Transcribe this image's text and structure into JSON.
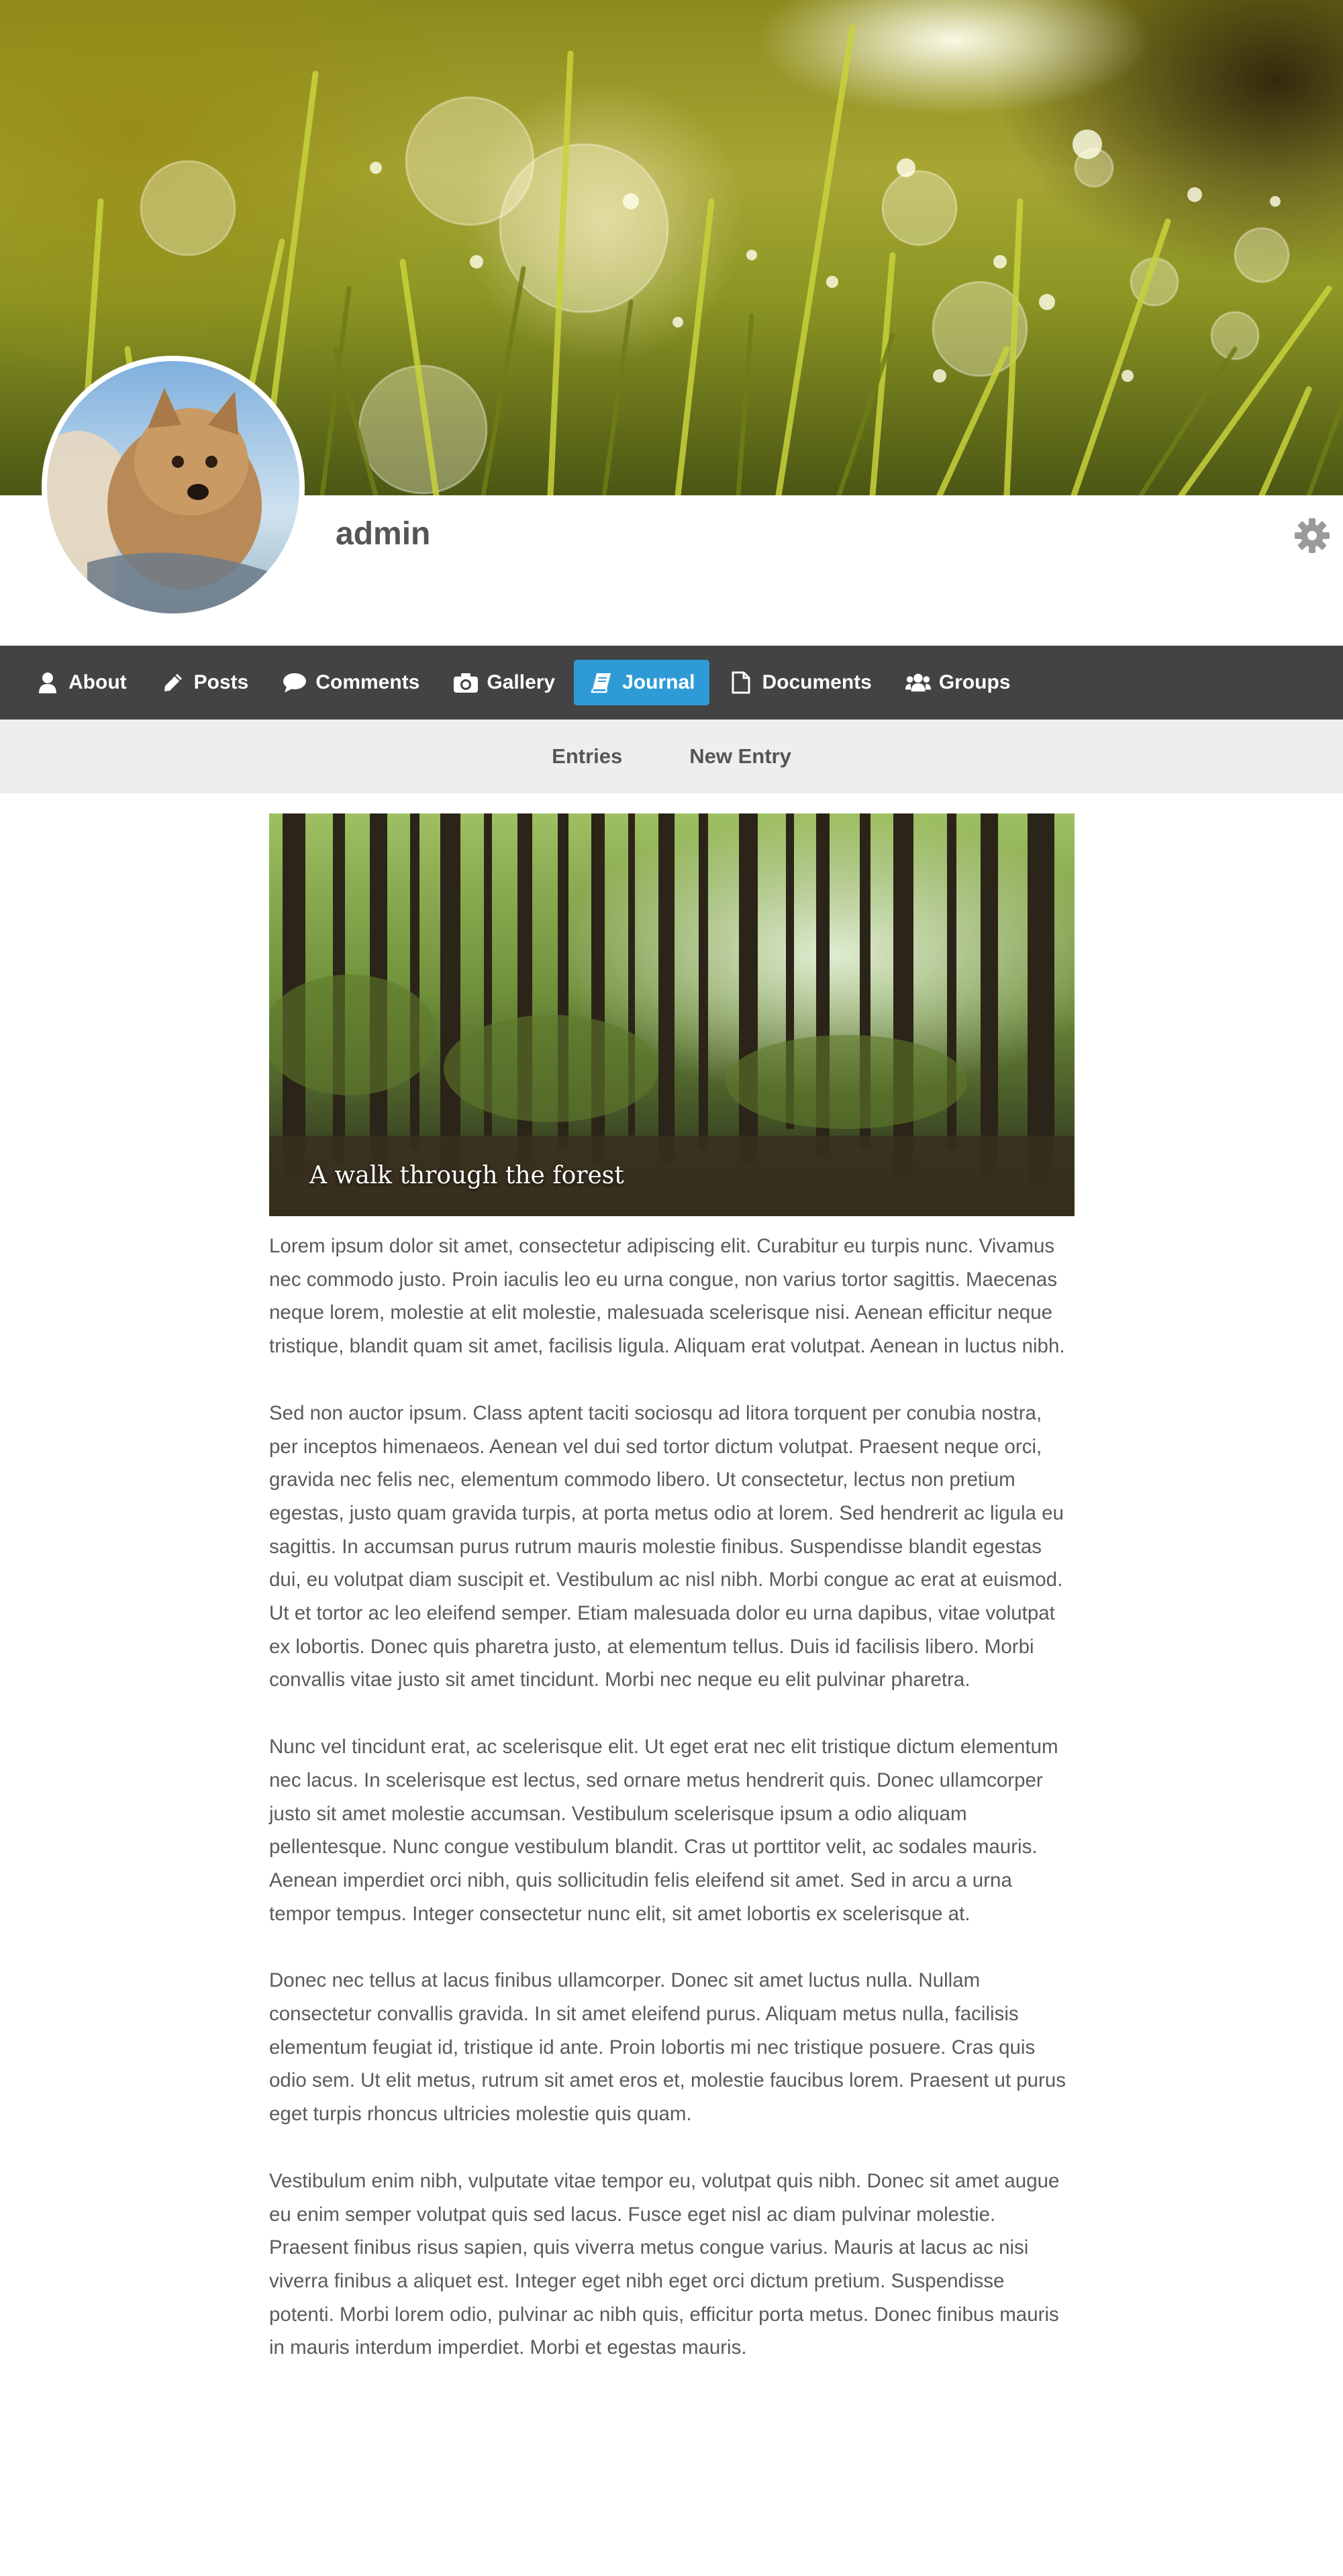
{
  "profile": {
    "username": "admin",
    "settings_icon": "gear-icon",
    "avatar_desc": "avatar-photo"
  },
  "nav": {
    "items": [
      {
        "label": "About",
        "icon": "user-icon",
        "active": false
      },
      {
        "label": "Posts",
        "icon": "pencil-icon",
        "active": false
      },
      {
        "label": "Comments",
        "icon": "comment-icon",
        "active": false
      },
      {
        "label": "Gallery",
        "icon": "camera-icon",
        "active": false
      },
      {
        "label": "Journal",
        "icon": "book-icon",
        "active": true
      },
      {
        "label": "Documents",
        "icon": "document-icon",
        "active": false
      },
      {
        "label": "Groups",
        "icon": "users-icon",
        "active": false
      }
    ],
    "active_color": "#2f9bd6",
    "bar_color": "#434343"
  },
  "subnav": {
    "items": [
      {
        "label": "Entries"
      },
      {
        "label": "New Entry"
      }
    ]
  },
  "entry": {
    "caption": "A walk through the forest",
    "paragraphs": [
      "Lorem ipsum dolor sit amet, consectetur adipiscing elit. Curabitur eu turpis nunc. Vivamus nec commodo justo. Proin iaculis leo eu urna congue, non varius tortor sagittis. Maecenas neque lorem, molestie at elit molestie, malesuada scelerisque nisi. Aenean efficitur neque tristique, blandit quam sit amet, facilisis ligula. Aliquam erat volutpat. Aenean in luctus nibh.",
      "Sed non auctor ipsum. Class aptent taciti sociosqu ad litora torquent per conubia nostra, per inceptos himenaeos. Aenean vel dui sed tortor dictum volutpat. Praesent neque orci, gravida nec felis nec, elementum commodo libero. Ut consectetur, lectus non pretium egestas, justo quam gravida turpis, at porta metus odio at lorem. Sed hendrerit ac ligula eu sagittis. In accumsan purus rutrum mauris molestie finibus. Suspendisse blandit egestas dui, eu volutpat diam suscipit et. Vestibulum ac nisl nibh. Morbi congue ac erat at euismod. Ut et tortor ac leo eleifend semper. Etiam malesuada dolor eu urna dapibus, vitae volutpat ex lobortis. Donec quis pharetra justo, at elementum tellus. Duis id facilisis libero. Morbi convallis vitae justo sit amet tincidunt. Morbi nec neque eu elit pulvinar pharetra.",
      "Nunc vel tincidunt erat, ac scelerisque elit. Ut eget erat nec elit tristique dictum elementum nec lacus. In scelerisque est lectus, sed ornare metus hendrerit quis. Donec ullamcorper justo sit amet molestie accumsan. Vestibulum scelerisque ipsum a odio aliquam pellentesque. Nunc congue vestibulum blandit. Cras ut porttitor velit, ac sodales mauris. Aenean imperdiet orci nibh, quis sollicitudin felis eleifend sit amet. Sed in arcu a urna tempor tempus. Integer consectetur nunc elit, sit amet lobortis ex scelerisque at.",
      "Donec nec tellus at lacus finibus ullamcorper. Donec sit amet luctus nulla. Nullam consectetur convallis gravida. In sit amet eleifend purus. Aliquam metus nulla, facilisis elementum feugiat id, tristique id ante. Proin lobortis mi nec tristique posuere. Cras quis odio sem. Ut elit metus, rutrum sit amet eros et, molestie faucibus lorem. Praesent ut purus eget turpis rhoncus ultricies molestie quis quam.",
      "Vestibulum enim nibh, vulputate vitae tempor eu, volutpat quis nibh. Donec sit amet augue eu enim semper volutpat quis sed lacus. Fusce eget nisl ac diam pulvinar molestie. Praesent finibus risus sapien, quis viverra metus congue varius. Mauris at lacus ac nisi viverra finibus a aliquet est. Integer eget nibh eget orci dictum pretium. Suspendisse potenti. Morbi lorem odio, pulvinar ac nibh quis, efficitur porta metus. Donec finibus mauris in mauris interdum imperdiet. Morbi et egestas mauris."
    ]
  }
}
